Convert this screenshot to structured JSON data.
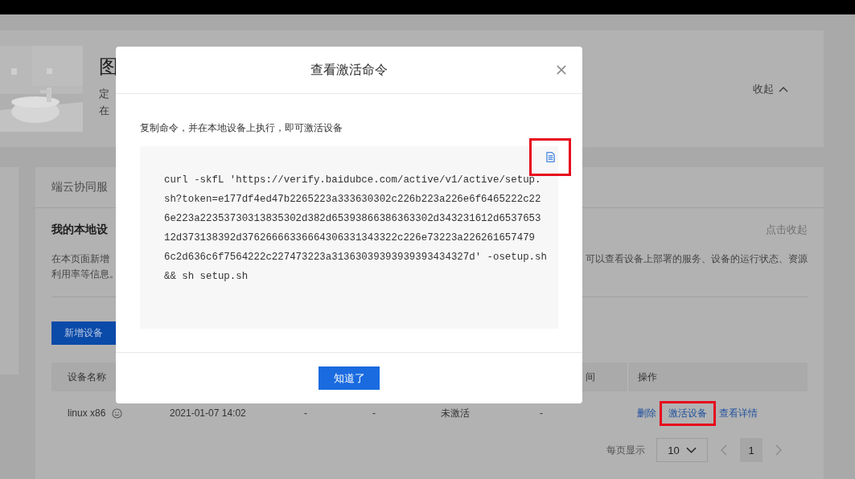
{
  "banner": {
    "title": "图",
    "desc_lines": [
      "定",
      "在"
    ],
    "collapse": "收起"
  },
  "panel": {
    "tab": "端云协同服",
    "section_title": "我的本地设",
    "collapse": "点击收起",
    "description_left": "在本页面新增",
    "description_right": "可以查看设备上部署的服务、设备的运行状态、资源",
    "description_line2": "利用率等信息。",
    "add_button": "新增设备"
  },
  "table": {
    "columns": [
      {
        "label": "设备名称"
      },
      {},
      {},
      {},
      {},
      {
        "label": "间"
      },
      {
        "label": "操作"
      }
    ],
    "rows": [
      {
        "name": "linux x86",
        "cells": [
          "2021-01-07 14:02",
          "-",
          "-",
          "未激活",
          "-"
        ],
        "actions": [
          {
            "label": "删除",
            "highlighted": false
          },
          {
            "label": "激活设备",
            "highlighted": true
          },
          {
            "label": "查看详情",
            "highlighted": false
          }
        ]
      }
    ]
  },
  "pagination": {
    "page_size_label": "每页显示",
    "page_size": "10",
    "pages": [
      {
        "label": "1",
        "selected": true
      }
    ]
  },
  "dialog": {
    "title": "查看激活命令",
    "instruction": "复制命令，并在本地设备上执行，即可激活设备",
    "copy_highlighted": true,
    "command_lines": [
      "curl -skfL 'https://verify.baidubce.com/active/v1/active/setup.",
      "sh?token=e177df4ed47b2265223a333630302c226b223a226e6f6465222c22",
      "6e223a22353730313835302d382d65393866386363302d343231612d6537653",
      "12d373138392d37626666336664306331343322c226e73223a226261657479",
      "6c2d636c6f7564222c227473223a31363039393939393434327d' -osetup.sh",
      "&& sh setup.sh"
    ],
    "ok_button": "知道了"
  }
}
